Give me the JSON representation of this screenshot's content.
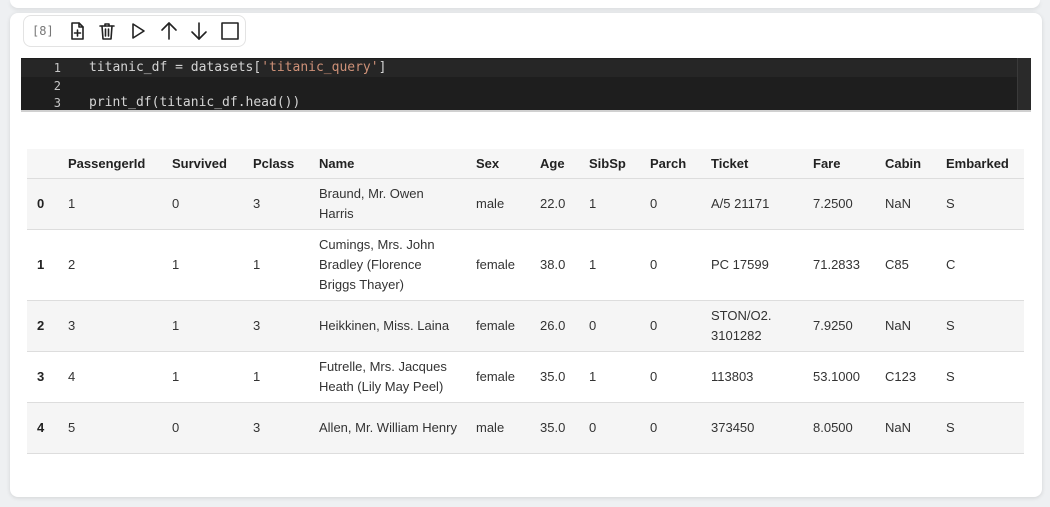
{
  "toolbar": {
    "execution_count": "[8]",
    "buttons": [
      "insert-cell",
      "delete-cell",
      "run-cell",
      "move-up",
      "move-down",
      "stop"
    ]
  },
  "editor": {
    "lines": [
      {
        "number": "1",
        "prefix": "titanic_df = datasets[",
        "string": "'titanic_query'",
        "suffix": "]"
      },
      {
        "number": "2",
        "prefix": "",
        "string": "",
        "suffix": ""
      },
      {
        "number": "3",
        "prefix": "print_df(titanic_df.head())",
        "string": "",
        "suffix": ""
      }
    ]
  },
  "table": {
    "columns": [
      "PassengerId",
      "Survived",
      "Pclass",
      "Name",
      "Sex",
      "Age",
      "SibSp",
      "Parch",
      "Ticket",
      "Fare",
      "Cabin",
      "Embarked"
    ],
    "rows": [
      {
        "index": "0",
        "cells": [
          "1",
          "0",
          "3",
          "Braund, Mr. Owen Harris",
          "male",
          "22.0",
          "1",
          "0",
          "A/5 21171",
          "7.2500",
          "NaN",
          "S"
        ]
      },
      {
        "index": "1",
        "cells": [
          "2",
          "1",
          "1",
          "Cumings, Mrs. John Bradley (Florence Briggs Thayer)",
          "female",
          "38.0",
          "1",
          "0",
          "PC 17599",
          "71.2833",
          "C85",
          "C"
        ]
      },
      {
        "index": "2",
        "cells": [
          "3",
          "1",
          "3",
          "Heikkinen, Miss. Laina",
          "female",
          "26.0",
          "0",
          "0",
          "STON/O2. 3101282",
          "7.9250",
          "NaN",
          "S"
        ]
      },
      {
        "index": "3",
        "cells": [
          "4",
          "1",
          "1",
          "Futrelle, Mrs. Jacques Heath (Lily May Peel)",
          "female",
          "35.0",
          "1",
          "0",
          "113803",
          "53.1000",
          "C123",
          "S"
        ]
      },
      {
        "index": "4",
        "cells": [
          "5",
          "0",
          "3",
          "Allen, Mr. William Henry",
          "male",
          "35.0",
          "0",
          "0",
          "373450",
          "8.0500",
          "NaN",
          "S"
        ]
      }
    ]
  }
}
